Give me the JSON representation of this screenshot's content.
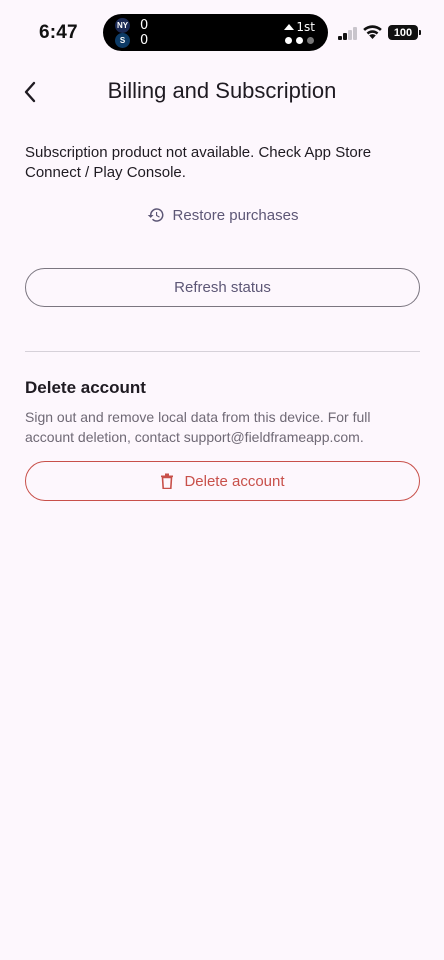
{
  "status_bar": {
    "time": "6:47",
    "live_activity": {
      "team1_logo": "NY",
      "team2_logo": "S",
      "team1_score": "0",
      "team2_score": "0",
      "inning": "1st"
    },
    "battery": "100"
  },
  "app_bar": {
    "title": "Billing and Subscription",
    "back_icon": "chevron-left-icon"
  },
  "billing": {
    "message": "Subscription product not available. Check App Store Connect / Play Console.",
    "restore_label": "Restore purchases",
    "restore_icon": "history-icon",
    "refresh_label": "Refresh status"
  },
  "delete_section": {
    "title": "Delete account",
    "description": "Sign out and remove local data from this device. For full account deletion, contact support@fieldframeapp.com.",
    "button_label": "Delete account",
    "button_icon": "trash-icon"
  },
  "colors": {
    "background": "#fdf7fd",
    "accent": "#5d5776",
    "danger": "#c8504a",
    "outline": "#7b7680"
  }
}
